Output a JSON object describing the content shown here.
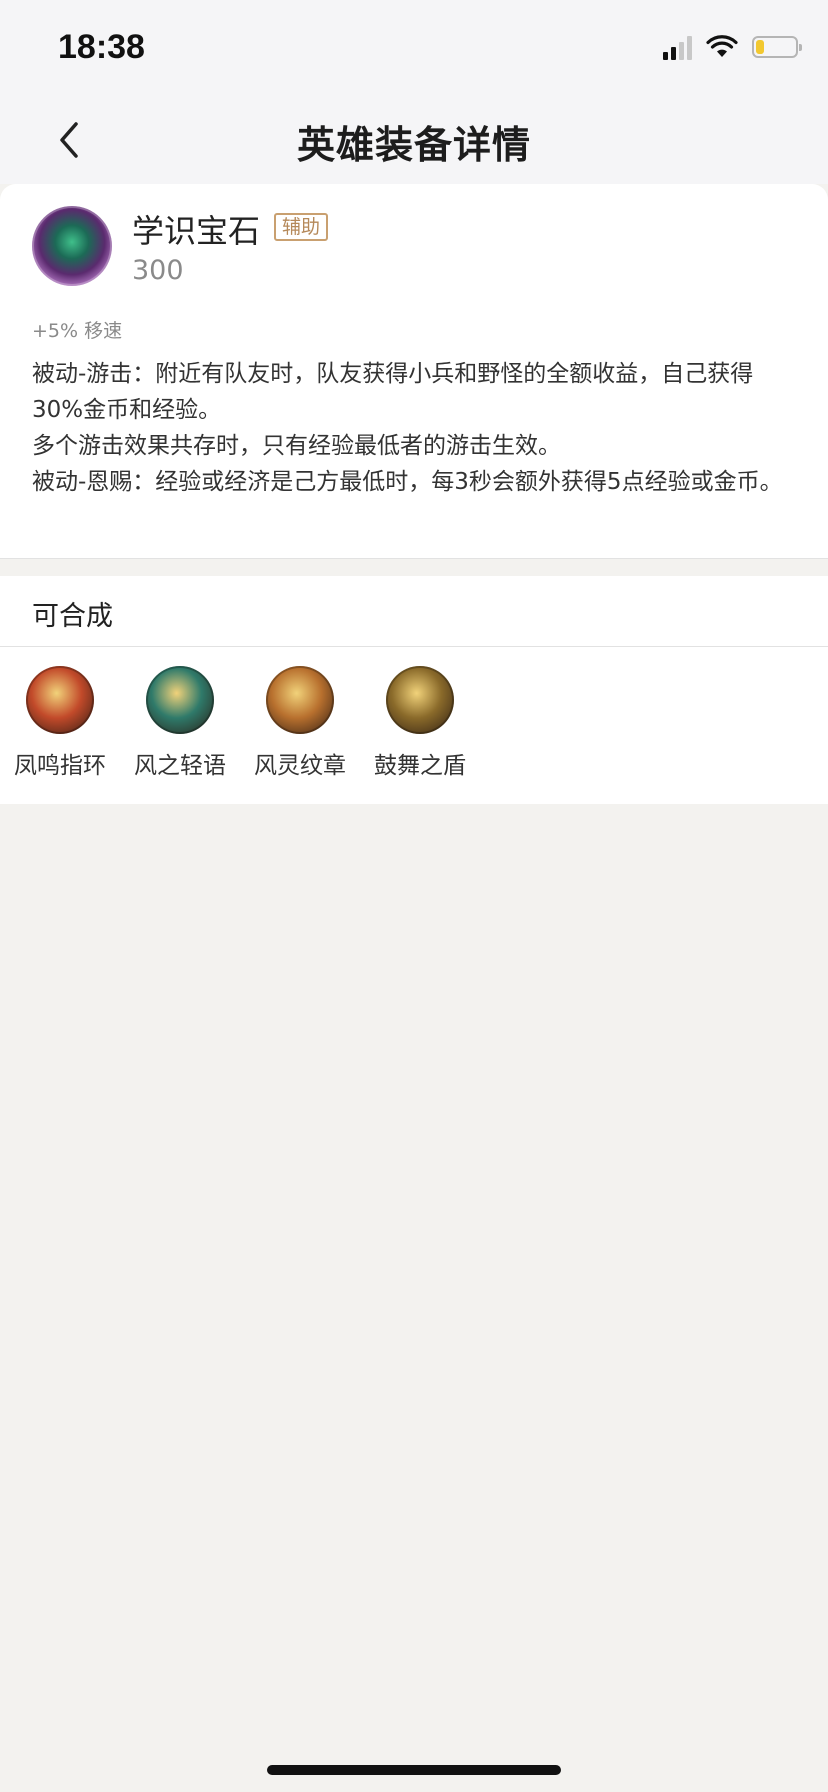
{
  "status_bar": {
    "time": "18:38",
    "signal_icon": "cellular-signal-icon",
    "wifi_icon": "wifi-icon",
    "battery_icon": "battery-icon",
    "battery_level": 0.2,
    "battery_color": "#f2c830"
  },
  "nav": {
    "back_icon": "chevron-left-icon",
    "title": "英雄装备详情"
  },
  "item": {
    "name": "学识宝石",
    "tag": "辅助",
    "price": "300",
    "attribute": "+5% 移速",
    "description": [
      "被动-游击：附近有队友时，队友获得小兵和野怪的全额收益，自己获得30%金币和经验。",
      "多个游击效果共存时，只有经验最低者的游击生效。",
      "被动-恩赐：经验或经济是己方最低时，每3秒会额外获得5点经验或金币。"
    ]
  },
  "compose": {
    "title": "可合成",
    "items": [
      {
        "name": "凤鸣指环",
        "icon": "ring-icon",
        "color": "#c24a2a"
      },
      {
        "name": "风之轻语",
        "icon": "ring-icon",
        "color": "#2f7a6a"
      },
      {
        "name": "风灵纹章",
        "icon": "emblem-icon",
        "color": "#b8702e"
      },
      {
        "name": "鼓舞之盾",
        "icon": "shield-icon",
        "color": "#8a6a2a"
      }
    ]
  },
  "colors": {
    "tag": "#b5895a",
    "page_background": "#f3f2ef"
  }
}
